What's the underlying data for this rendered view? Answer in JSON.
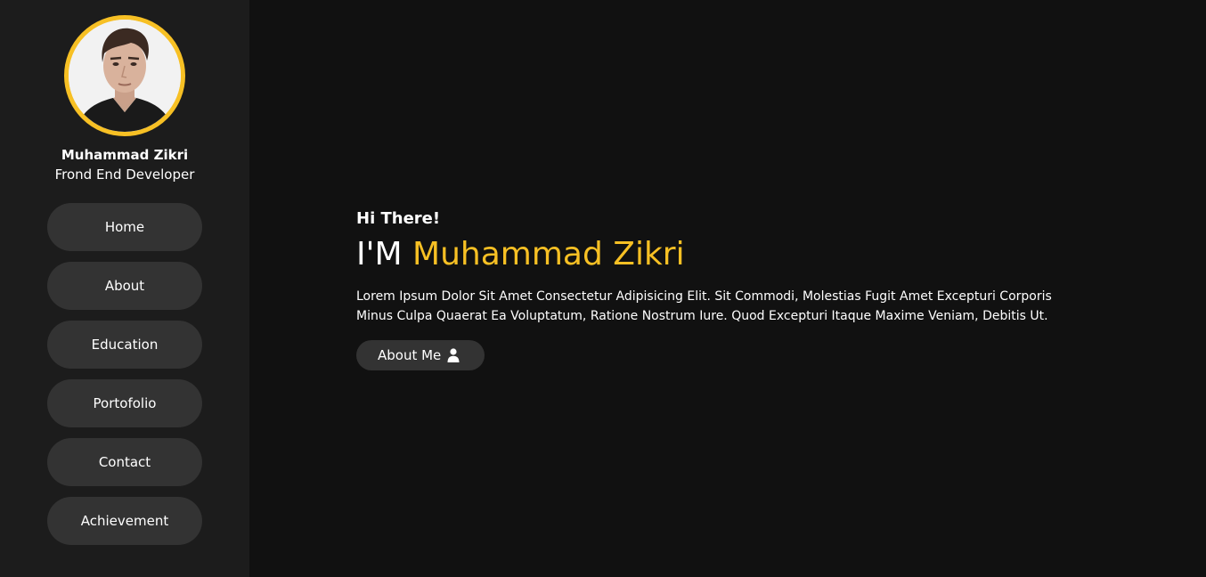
{
  "profile": {
    "name": "Muhammad Zikri",
    "role": "Frond End Developer"
  },
  "nav": {
    "items": [
      {
        "label": "Home"
      },
      {
        "label": "About"
      },
      {
        "label": "Education"
      },
      {
        "label": "Portofolio"
      },
      {
        "label": "Contact"
      },
      {
        "label": "Achievement"
      }
    ]
  },
  "hero": {
    "greeting": "Hi There!",
    "prefix": "I'M ",
    "name": "Muhammad Zikri",
    "bio": "Lorem Ipsum Dolor Sit Amet Consectetur Adipisicing Elit. Sit Commodi, Molestias Fugit Amet Excepturi Corporis Minus Culpa Quaerat Ea Voluptatum, Ratione Nostrum Iure. Quod Excepturi Itaque Maxime Veniam, Debitis Ut.",
    "button_label": "About Me",
    "button_icon": "user-icon"
  },
  "colors": {
    "accent": "#f7c024",
    "page_background": "#111111",
    "sidebar_background": "#1c1c1c",
    "button_background": "#333333",
    "text": "#ffffff"
  }
}
